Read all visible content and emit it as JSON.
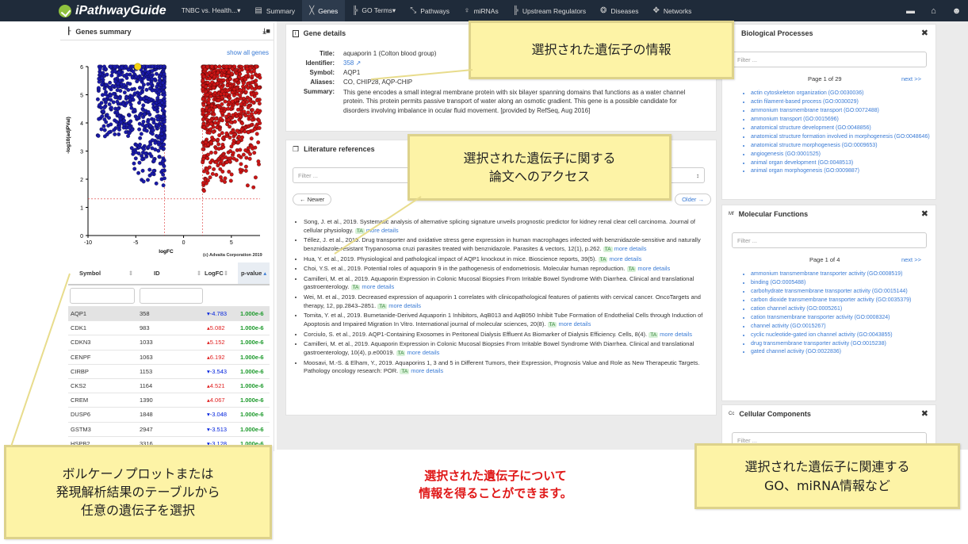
{
  "nav": {
    "logo": "iPathwayGuide",
    "items": [
      {
        "icon": "",
        "label": "TNBC vs. Health...▾"
      },
      {
        "icon": "▤",
        "label": "Summary"
      },
      {
        "icon": "╳",
        "label": "Genes"
      },
      {
        "icon": "╠",
        "label": "GO Terms▾"
      },
      {
        "icon": "⤡",
        "label": "Pathways"
      },
      {
        "icon": "♀",
        "label": "miRNAs"
      },
      {
        "icon": "╠",
        "label": "Upstream Regulators"
      },
      {
        "icon": "❂",
        "label": "Diseases"
      },
      {
        "icon": "✥",
        "label": "Networks"
      }
    ],
    "right_icons": [
      "▬",
      "⌂",
      "☻"
    ]
  },
  "genes_summary": {
    "title": "Genes summary",
    "show_all": "show all genes",
    "copyright": "(c) Advaita Corporation 2019",
    "columns": [
      "Symbol",
      "ID",
      "LogFC",
      "p-value"
    ],
    "rows": [
      {
        "symbol": "AQP1",
        "id": "358",
        "lfc": "-4.783",
        "dir": "down",
        "p": "1.000e-6"
      },
      {
        "symbol": "CDK1",
        "id": "983",
        "lfc": "5.082",
        "dir": "up",
        "p": "1.000e-6"
      },
      {
        "symbol": "CDKN3",
        "id": "1033",
        "lfc": "5.152",
        "dir": "up",
        "p": "1.000e-6"
      },
      {
        "symbol": "CENPF",
        "id": "1063",
        "lfc": "6.192",
        "dir": "up",
        "p": "1.000e-6"
      },
      {
        "symbol": "CIRBP",
        "id": "1153",
        "lfc": "-3.543",
        "dir": "down",
        "p": "1.000e-6"
      },
      {
        "symbol": "CKS2",
        "id": "1164",
        "lfc": "4.521",
        "dir": "up",
        "p": "1.000e-6"
      },
      {
        "symbol": "CREM",
        "id": "1390",
        "lfc": "4.067",
        "dir": "up",
        "p": "1.000e-6"
      },
      {
        "symbol": "DUSP6",
        "id": "1848",
        "lfc": "-3.048",
        "dir": "down",
        "p": "1.000e-6"
      },
      {
        "symbol": "GSTM3",
        "id": "2947",
        "lfc": "-3.513",
        "dir": "down",
        "p": "1.000e-6"
      },
      {
        "symbol": "HSPB2",
        "id": "3316",
        "lfc": "-3.128",
        "dir": "down",
        "p": "1.000e-6"
      }
    ]
  },
  "chart_data": {
    "type": "scatter",
    "xlabel": "logFC",
    "ylabel": "-log10(adjPVal)",
    "xlim": [
      -10,
      8
    ],
    "ylim": [
      0,
      6
    ],
    "xticks": [
      -10,
      -5,
      0,
      5
    ],
    "yticks": [
      0,
      1,
      2,
      3,
      4,
      5,
      6
    ],
    "thresholds": {
      "x": [
        -2,
        2
      ],
      "y": 1.3
    },
    "selected_point": {
      "x": -4.8,
      "y": 6
    },
    "colors": {
      "down": "#1a1aa8",
      "up": "#cc1515",
      "selected": "#f5d315",
      "threshold": "#d33"
    },
    "series": [
      {
        "dir": "down",
        "x_range": [
          -9,
          -2
        ],
        "density": "high"
      },
      {
        "dir": "up",
        "x_range": [
          2,
          8
        ],
        "density": "high"
      }
    ]
  },
  "gene_details": {
    "title": "Gene details",
    "fields": [
      {
        "label": "Title:",
        "value": "aquaporin 1 (Colton blood group)"
      },
      {
        "label": "Identifier:",
        "value": "358"
      },
      {
        "label": "Symbol:",
        "value": "AQP1"
      },
      {
        "label": "Aliases:",
        "value": "CO, CHIP28, AQP-CHIP"
      }
    ],
    "summary_label": "Summary:",
    "summary": "This gene encodes a small integral membrane protein with six bilayer spanning domains that functions as a water channel protein. This protein permits passive transport of water along an osmotic gradient. This gene is a possible candidate for disorders involving imbalance in ocular fluid movement. [provided by RefSeq, Aug 2016]"
  },
  "literature": {
    "title": "Literature references",
    "filter_placeholder": "Filter ...",
    "newer": "← Newer",
    "older": "Older →",
    "more": "more details",
    "items": [
      {
        "text": "Song, J. et al., 2019. Systematic analysis of alternative splicing signature unveils prognostic predictor for kidney renal clear cell carcinoma. Journal of cellular physiology.",
        "ta": "TA"
      },
      {
        "text": "Téllez, J. et al., 2019. Drug transporter and oxidative stress gene expression in human macrophages infected with benznidazole-sensitive and naturally benznidazole-resistant Trypanosoma cruzi parasites treated with benznidazole. Parasites & vectors, 12(1), p.262.",
        "ta": "TA"
      },
      {
        "text": "Hua, Y. et al., 2019. Physiological and pathological impact of AQP1 knockout in mice. Bioscience reports, 39(5).",
        "ta": "TA"
      },
      {
        "text": "Choi, Y.S. et al., 2019. Potential roles of aquaporin 9 in the pathogenesis of endometriosis. Molecular human reproduction.",
        "ta": "TA"
      },
      {
        "text": "Camilleri, M. et al., 2019. Aquaporin Expression in Colonic Mucosal Biopsies From Irritable Bowel Syndrome With Diarrhea. Clinical and translational gastroenterology.",
        "ta": "TA"
      },
      {
        "text": "Wei, M. et al., 2019. Decreased expression of aquaporin 1 correlates with clinicopathological features of patients with cervical cancer. OncoTargets and therapy, 12, pp.2843–2851.",
        "ta": "TA"
      },
      {
        "text": "Tomita, Y. et al., 2019. Bumetanide-Derived Aquaporin 1 Inhibitors, AqB013 and AqB050 Inhibit Tube Formation of Endothelial Cells through Induction of Apoptosis and Impaired Migration In Vitro. International journal of molecular sciences, 20(8).",
        "ta": "TA"
      },
      {
        "text": "Corciulo, S. et al., 2019. AQP1-Containing Exosomes in Peritoneal Dialysis Effluent As Biomarker of Dialysis Efficiency. Cells, 8(4).",
        "ta": "TA"
      },
      {
        "text": "Camilleri, M. et al., 2019. Aquaporin Expression in Colonic Mucosal Biopsies From Irritable Bowel Syndrome With Diarrhea. Clinical and translational gastroenterology, 10(4), p.e00019.",
        "ta": "TA"
      },
      {
        "text": "Moosavi, M.-S. & Elham, Y., 2019. Aquaporins 1, 3 and 5 in Different Tumors, their Expression, Prognosis Value and Role as New Therapeutic Targets. Pathology oncology research: POR.",
        "ta": "TA"
      }
    ]
  },
  "bio_processes": {
    "title": "Biological Processes",
    "filter_placeholder": "Filter ...",
    "page": "Page 1 of 29",
    "next": "next >>",
    "items": [
      "actin cytoskeleton organization (GO:0030036)",
      "actin filament-based process (GO:0030029)",
      "ammonium transmembrane transport (GO:0072488)",
      "ammonium transport (GO:0015696)",
      "anatomical structure development (GO:0048856)",
      "anatomical structure formation involved in morphogenesis (GO:0048646)",
      "anatomical structure morphogenesis (GO:0009653)",
      "angiogenesis (GO:0001525)",
      "animal organ development (GO:0048513)",
      "animal organ morphogenesis (GO:0009887)"
    ]
  },
  "mol_functions": {
    "title": "Molecular Functions",
    "filter_placeholder": "Filter ...",
    "page": "Page 1 of 4",
    "next": "next >>",
    "items": [
      "ammonium transmembrane transporter activity (GO:0008519)",
      "binding (GO:0005488)",
      "carbohydrate transmembrane transporter activity (GO:0015144)",
      "carbon dioxide transmembrane transporter activity (GO:0035379)",
      "cation channel activity (GO:0005261)",
      "cation transmembrane transporter activity (GO:0008324)",
      "channel activity (GO:0015267)",
      "cyclic nucleotide-gated ion channel activity (GO:0043855)",
      "drug transmembrane transporter activity (GO:0015238)",
      "gated channel activity (GO:0022836)"
    ]
  },
  "cell_components": {
    "title": "Cellular Components",
    "filter_placeholder": "Filter ..."
  },
  "callouts": {
    "gene_info": "選択された遺伝子の情報",
    "lit_line1": "選択された遺伝子に関する",
    "lit_line2": "論文へのアクセス",
    "select_line1": "ボルケーノプロットまたは",
    "select_line2": "発現解析結果のテーブルから",
    "select_line3": "任意の遺伝子を選択",
    "go_line1": "選択された遺伝子に関連する",
    "go_line2": "GO、miRNA情報など",
    "red_line1": "選択された遺伝子について",
    "red_line2": "情報を得ることができます。"
  }
}
